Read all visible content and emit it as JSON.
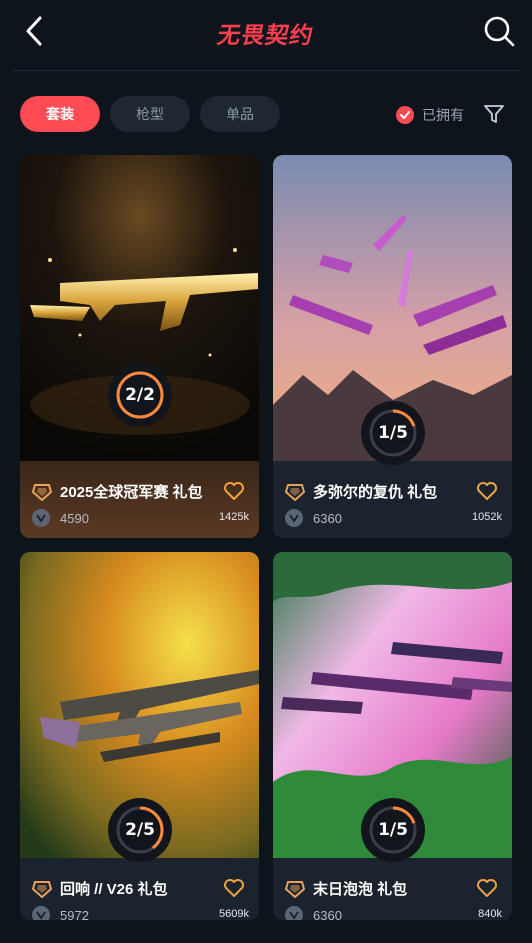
{
  "header": {
    "title": "无畏契约",
    "back_icon": "chevron-left-icon",
    "search_icon": "search-icon"
  },
  "filters": {
    "tabs": [
      {
        "label": "套装",
        "active": true
      },
      {
        "label": "枪型",
        "active": false
      },
      {
        "label": "单品",
        "active": false
      }
    ],
    "owned_label": "已拥有",
    "owned_checked": true,
    "filter_icon": "funnel-icon"
  },
  "colors": {
    "accent": "#ff4b53",
    "background": "#0e141b"
  },
  "bundles": [
    {
      "name": "2025全球冠军赛 礼包",
      "price": "4590",
      "likes": "1425k",
      "progress": "2/2",
      "owned_fraction": 1.0
    },
    {
      "name": "多弥尔的复仇 礼包",
      "price": "6360",
      "likes": "1052k",
      "progress": "1/5",
      "owned_fraction": 0.2
    },
    {
      "name": "回响 // V26 礼包",
      "price": "5972",
      "likes": "5609k",
      "progress": "2/5",
      "owned_fraction": 0.4
    },
    {
      "name": "末日泡泡 礼包",
      "price": "6360",
      "likes": "840k",
      "progress": "1/5",
      "owned_fraction": 0.2
    }
  ]
}
